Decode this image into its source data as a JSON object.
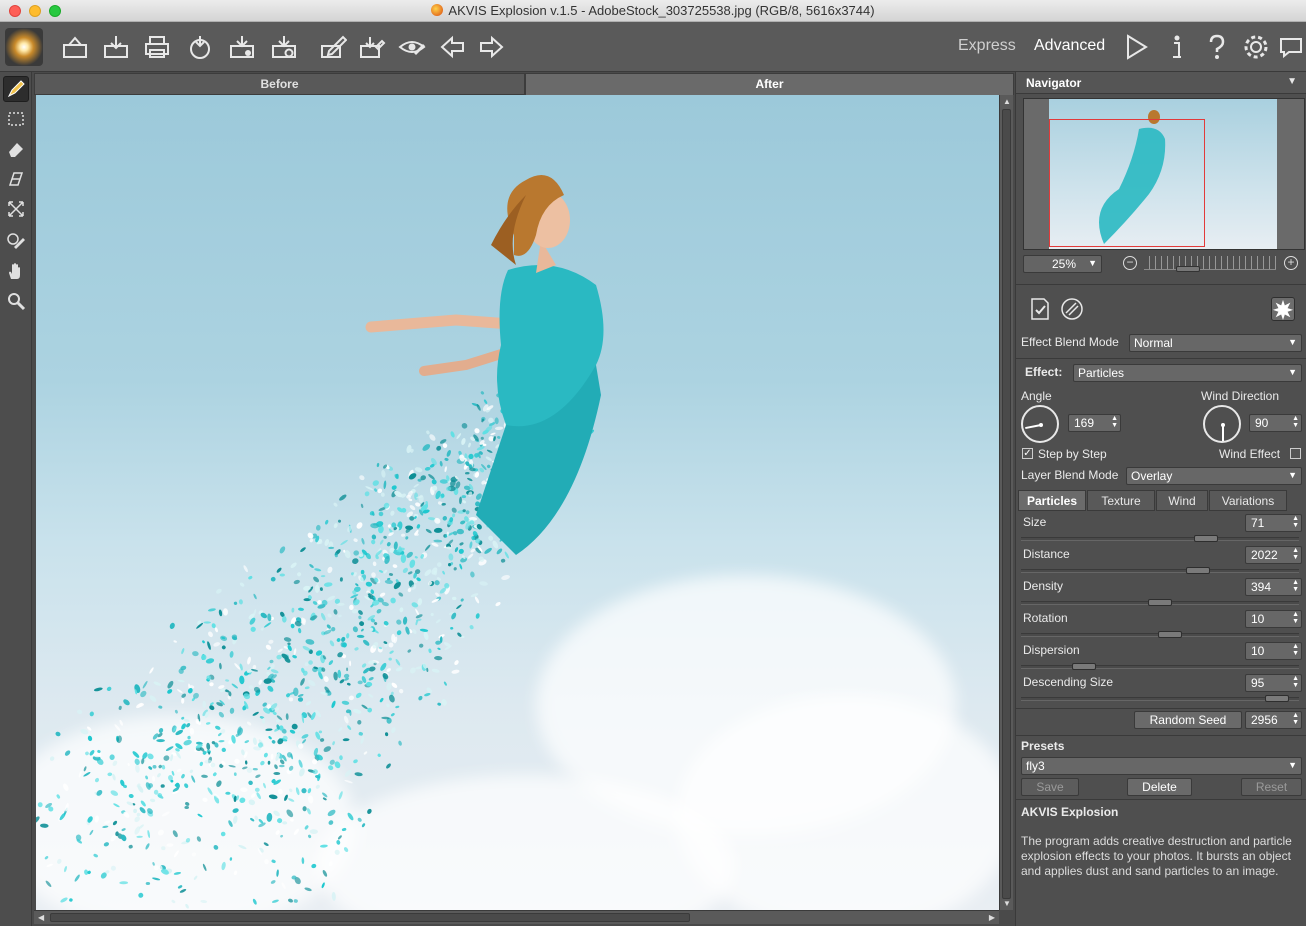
{
  "window": {
    "title": "AKVIS Explosion v.1.5 - AdobeStock_303725538.jpg (RGB/8, 5616x3744)"
  },
  "toolbar": {
    "buttons": [
      {
        "name": "open-image-icon"
      },
      {
        "name": "save-image-icon"
      },
      {
        "name": "print-icon"
      },
      {
        "name": "share-icon"
      },
      {
        "name": "batch-processing-icon"
      },
      {
        "name": "preferences-export-icon"
      },
      {
        "name": "load-strokes-icon"
      },
      {
        "name": "save-strokes-icon"
      },
      {
        "name": "show-strokes-icon"
      },
      {
        "name": "undo-icon"
      },
      {
        "name": "redo-icon"
      }
    ],
    "mode_express": "Express",
    "mode_advanced": "Advanced"
  },
  "tools": [
    "selection-brush-icon",
    "lasso-icon",
    "eraser-icon",
    "direction-icon",
    "transform-icon",
    "history-brush-icon",
    "hand-icon",
    "zoom-icon"
  ],
  "view_tabs": {
    "before": "Before",
    "after": "After"
  },
  "navigator": {
    "title": "Navigator",
    "zoom": "25%"
  },
  "settings": {
    "effect_blend_mode_label": "Effect Blend Mode",
    "effect_blend_mode_value": "Normal",
    "effect_label": "Effect:",
    "effect_value": "Particles",
    "angle_label": "Angle",
    "angle_value": "169",
    "wind_direction_label": "Wind Direction",
    "wind_direction_value": "90",
    "step_by_step_label": "Step by Step",
    "step_by_step_checked": true,
    "wind_effect_label": "Wind Effect",
    "wind_effect_checked": false,
    "layer_blend_mode_label": "Layer Blend Mode",
    "layer_blend_mode_value": "Overlay"
  },
  "param_tabs": [
    "Particles",
    "Texture",
    "Wind",
    "Variations"
  ],
  "params": [
    {
      "label": "Size",
      "value": "71",
      "level": 0.68
    },
    {
      "label": "Distance",
      "value": "2022",
      "level": 0.65
    },
    {
      "label": "Density",
      "value": "394",
      "level": 0.5
    },
    {
      "label": "Rotation",
      "value": "10",
      "level": 0.54
    },
    {
      "label": "Dispersion",
      "value": "10",
      "level": 0.2
    },
    {
      "label": "Descending Size",
      "value": "95",
      "level": 0.96
    }
  ],
  "random_seed": {
    "label": "Random Seed",
    "value": "2956"
  },
  "presets": {
    "title": "Presets",
    "selected": "fly3",
    "save_label": "Save",
    "delete_label": "Delete",
    "reset_label": "Reset"
  },
  "about": {
    "title": "AKVIS Explosion",
    "text": "The program adds creative destruction and particle explosion effects to your photos. It bursts an object and applies dust and sand particles to an image."
  },
  "colors": {
    "particles": "#1ec8cf",
    "dress": "#2ab9c2",
    "sky": "#9cc9da"
  }
}
